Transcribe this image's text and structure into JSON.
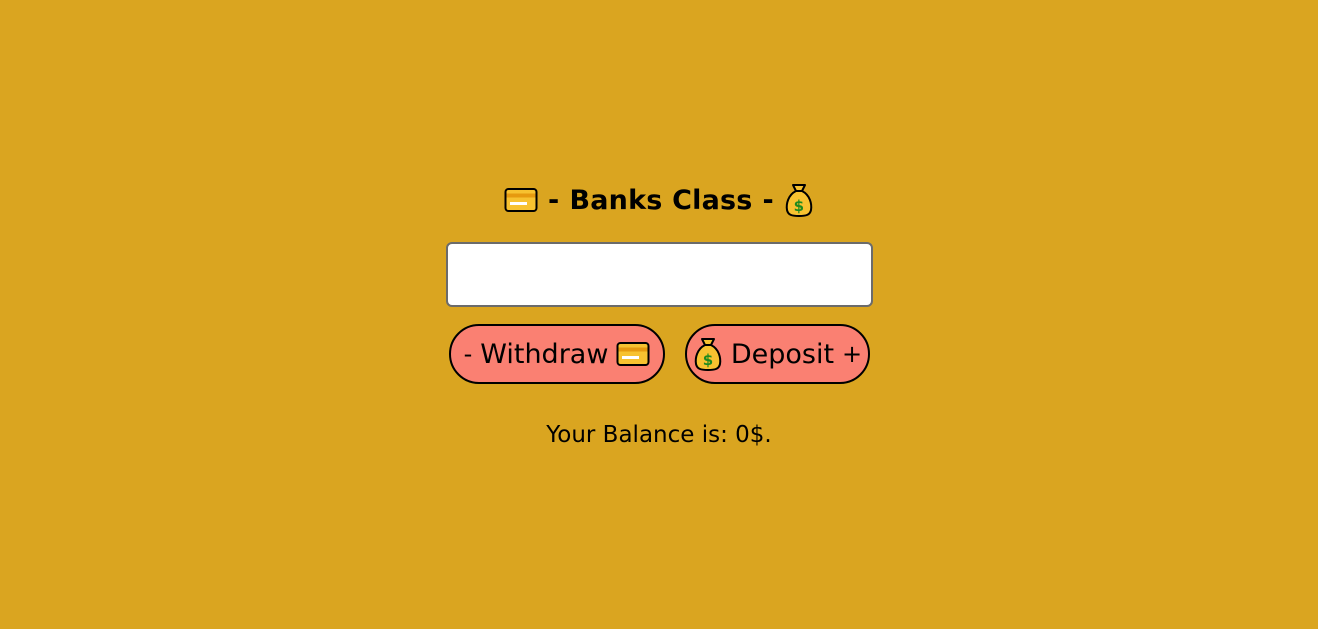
{
  "title": {
    "prefix": "-",
    "text": "Banks Class",
    "suffix": "-",
    "left_icon": "credit-card-icon",
    "right_icon": "money-bag-icon"
  },
  "amount_input": {
    "value": "",
    "placeholder": ""
  },
  "buttons": {
    "withdraw": {
      "sign": "-",
      "label": "Withdraw",
      "icon": "credit-card-icon"
    },
    "deposit": {
      "icon": "money-bag-icon",
      "label": "Deposit",
      "sign": "+"
    }
  },
  "balance": {
    "text": "Your Balance is: 0$."
  },
  "colors": {
    "background": "#DAA520",
    "button": "#FA8072",
    "card": "#F7C230",
    "bag": "#F7C230"
  }
}
